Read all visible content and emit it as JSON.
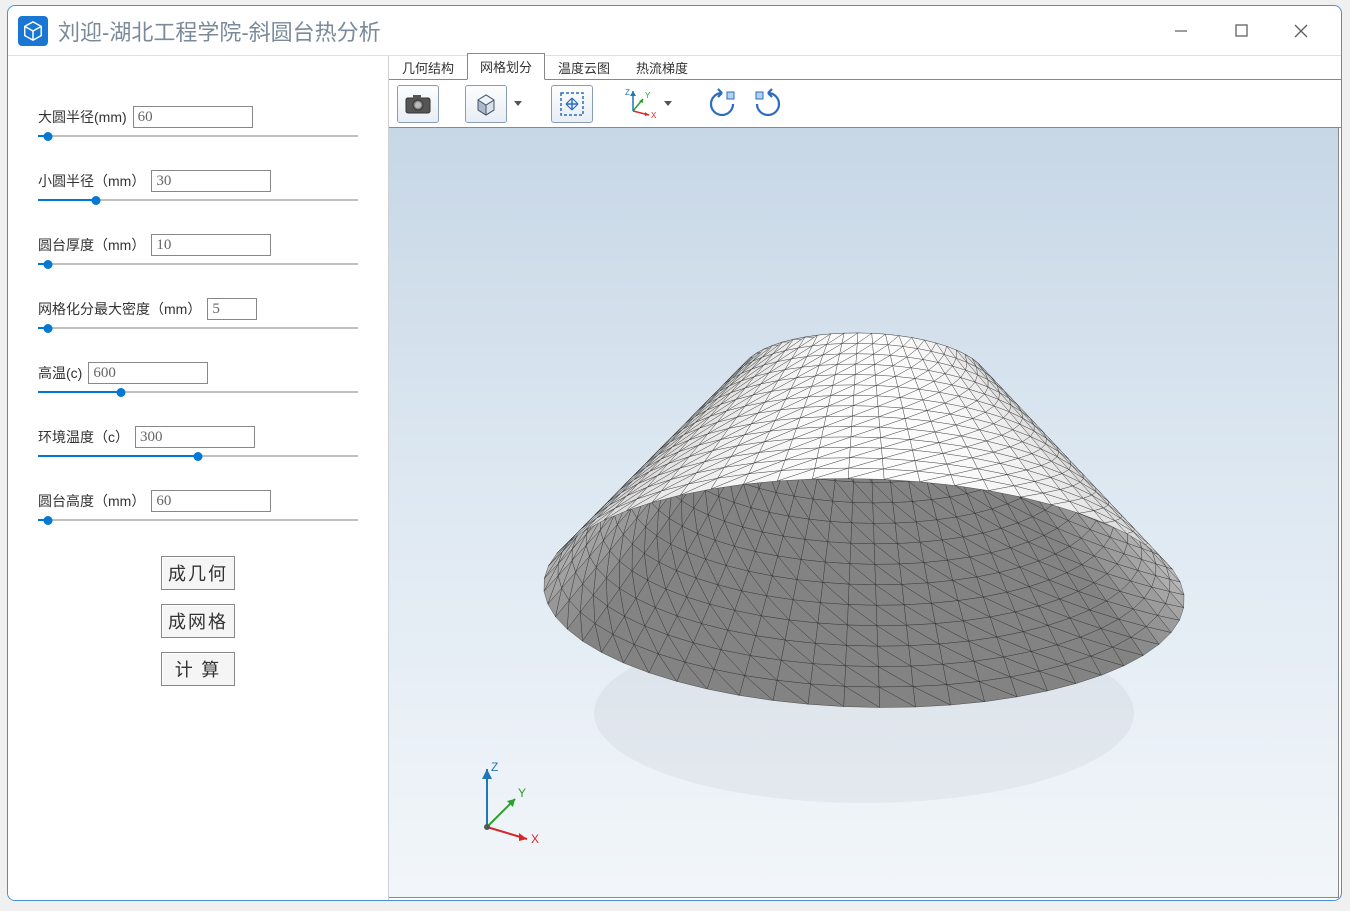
{
  "window": {
    "title": "刘迎-湖北工程学院-斜圆台热分析"
  },
  "params": [
    {
      "label": "大圆半径(mm)",
      "value": "60",
      "fill_pct": 3
    },
    {
      "label": "小圆半径（mm）",
      "value": "30",
      "fill_pct": 18
    },
    {
      "label": "圆台厚度（mm）",
      "value": "10",
      "fill_pct": 3
    },
    {
      "label": "网格化分最大密度（mm）",
      "value": "5",
      "fill_pct": 3
    },
    {
      "label": "高温(c)",
      "value": "600",
      "fill_pct": 26
    },
    {
      "label": "环境温度（c）",
      "value": "300",
      "fill_pct": 50
    },
    {
      "label": "圆台高度（mm）",
      "value": "60",
      "fill_pct": 3
    }
  ],
  "buttons": {
    "generate_geometry": "成几何",
    "generate_mesh": "成网格",
    "compute": "计 算"
  },
  "tabs": [
    {
      "label": "几何结构",
      "active": false
    },
    {
      "label": "网格划分",
      "active": true
    },
    {
      "label": "温度云图",
      "active": false
    },
    {
      "label": "热流梯度",
      "active": false
    }
  ],
  "triad_labels": {
    "x": "X",
    "y": "Y",
    "z": "Z"
  }
}
